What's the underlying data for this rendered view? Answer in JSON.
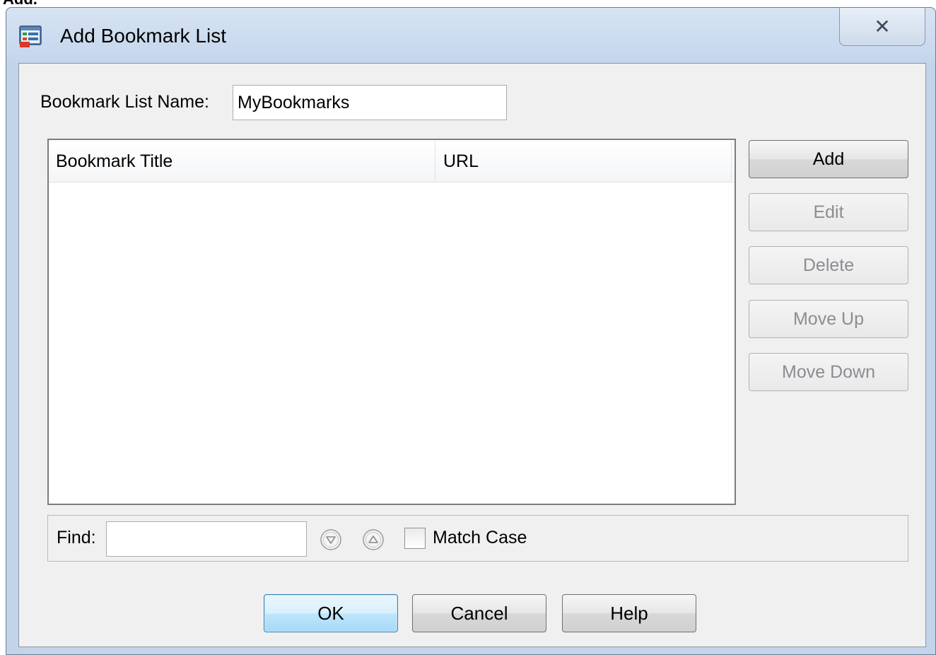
{
  "background_fragment": "Add.",
  "window": {
    "title": "Add Bookmark List",
    "close_glyph": "✕"
  },
  "form": {
    "name_label": "Bookmark List Name:",
    "name_value": "MyBookmarks"
  },
  "table": {
    "columns": [
      "Bookmark Title",
      "URL"
    ],
    "rows": []
  },
  "side_buttons": {
    "add": "Add",
    "edit": "Edit",
    "delete": "Delete",
    "move_up": "Move Up",
    "move_down": "Move Down"
  },
  "find": {
    "label": "Find:",
    "value": "",
    "match_case_label": "Match Case",
    "match_case_checked": false
  },
  "buttons": {
    "ok": "OK",
    "cancel": "Cancel",
    "help": "Help"
  },
  "icons": {
    "app": "bookmark-list-icon",
    "find_next": "find-next-down-icon",
    "find_prev": "find-previous-up-icon"
  }
}
